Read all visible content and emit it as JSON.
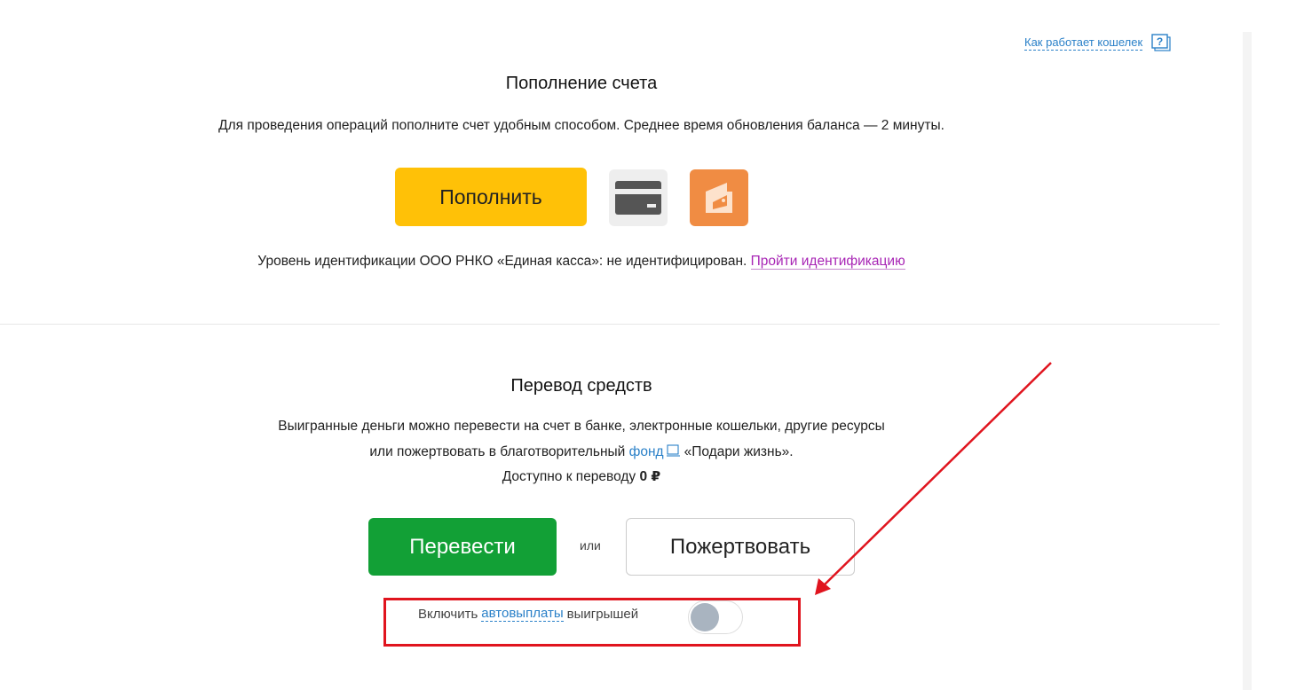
{
  "help": {
    "text": "Как работает кошелек",
    "icon": "help-question-icon"
  },
  "topup": {
    "title": "Пополнение счета",
    "description": "Для проведения операций пополните счет удобным способом. Среднее время обновления баланса — 2 минуты.",
    "button_label": "Пополнить",
    "methods": [
      {
        "icon": "bank-card-icon",
        "color": "#eeeeee"
      },
      {
        "icon": "wallet-icon",
        "color": "#f08c43"
      }
    ],
    "identification": {
      "prefix": "Уровень идентификации ООО РНКО «Единая касса»: не идентифицирован.",
      "link": "Пройти идентификацию"
    }
  },
  "transfer": {
    "title": "Перевод средств",
    "desc_line1": "Выигранные деньги можно перевести на счет в банке, электронные кошельки, другие ресурсы",
    "desc_line2_prefix": "или пожертвовать в благотворительный",
    "fund_link": "фонд",
    "desc_line2_suffix": "«Подари жизнь».",
    "available_prefix": "Доступно к переводу",
    "available_amount": "0 ₽",
    "transfer_button": "Перевести",
    "or_label": "или",
    "donate_button": "Пожертвовать",
    "autopay": {
      "prefix": "Включить",
      "link": "автовыплаты",
      "suffix": "выигрышей",
      "enabled": false
    }
  },
  "colors": {
    "accent_yellow": "#ffc107",
    "accent_green": "#12a036",
    "link_blue": "#2a80c8",
    "link_purple": "#a826b5",
    "annotation_red": "#e0141e"
  }
}
